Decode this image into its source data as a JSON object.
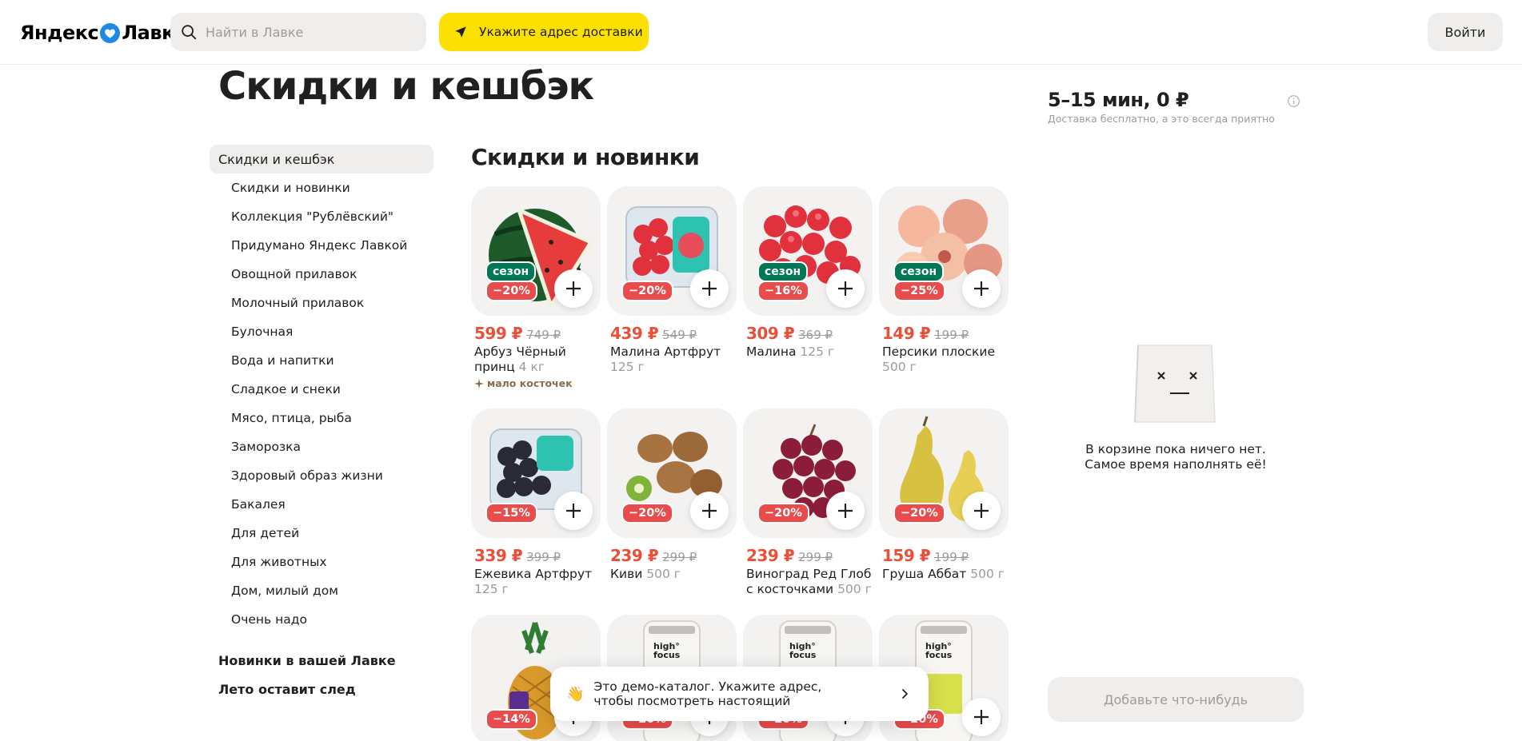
{
  "header": {
    "logo_left": "Яндекс",
    "logo_right": "Лавка",
    "search_placeholder": "Найти в Лавке",
    "address_label": "Укажите адрес доставки",
    "login_label": "Войти"
  },
  "page_title": "Скидки и кешбэк",
  "sidebar": {
    "active": "Скидки и кешбэк",
    "sub_items": [
      "Скидки и новинки",
      "Коллекция \"Рублёвский\"",
      "Придумано Яндекс Лавкой",
      "Овощной прилавок",
      "Молочный прилавок",
      "Булочная",
      "Вода и напитки",
      "Сладкое и снеки",
      "Мясо, птица, рыба",
      "Заморозка",
      "Здоровый образ жизни",
      "Бакалея",
      "Для детей",
      "Для животных",
      "Дом, милый дом",
      "Очень надо"
    ],
    "main_items": [
      "Новинки в вашей Лавке",
      "Лето оставит след"
    ]
  },
  "section_title": "Скидки и новинки",
  "products": [
    {
      "season": "сезон",
      "discount": "−20%",
      "price": "599 ₽",
      "old_price": "749 ₽",
      "name": "Арбуз Чёрный принц",
      "weight": "4 кг",
      "tag": "мало косточек",
      "art": "watermelon"
    },
    {
      "season": "",
      "discount": "−20%",
      "price": "439 ₽",
      "old_price": "549 ₽",
      "name": "Малина Артфрут",
      "weight": "125 г",
      "tag": "",
      "art": "raspberry-box"
    },
    {
      "season": "сезон",
      "discount": "−16%",
      "price": "309 ₽",
      "old_price": "369 ₽",
      "name": "Малина",
      "weight": "125 г",
      "tag": "",
      "art": "raspberry"
    },
    {
      "season": "сезон",
      "discount": "−25%",
      "price": "149 ₽",
      "old_price": "199 ₽",
      "name": "Персики плоские",
      "weight": "500 г",
      "tag": "",
      "art": "peach"
    },
    {
      "season": "",
      "discount": "−15%",
      "price": "339 ₽",
      "old_price": "399 ₽",
      "name": "Ежевика Артфрут",
      "weight": "125 г",
      "tag": "",
      "art": "blackberry-box"
    },
    {
      "season": "",
      "discount": "−20%",
      "price": "239 ₽",
      "old_price": "299 ₽",
      "name": "Киви",
      "weight": "500 г",
      "tag": "",
      "art": "kiwi"
    },
    {
      "season": "",
      "discount": "−20%",
      "price": "239 ₽",
      "old_price": "299 ₽",
      "name": "Виноград Ред Глоб с косточками",
      "weight": "500 г",
      "tag": "",
      "art": "grapes"
    },
    {
      "season": "",
      "discount": "−20%",
      "price": "159 ₽",
      "old_price": "199 ₽",
      "name": "Груша Аббат",
      "weight": "500 г",
      "tag": "",
      "art": "pear"
    },
    {
      "season": "",
      "discount": "−14%",
      "price": "",
      "old_price": "",
      "name": "",
      "weight": "",
      "tag": "",
      "art": "pineapple"
    },
    {
      "season": "",
      "discount": "−20%",
      "price": "",
      "old_price": "",
      "name": "",
      "weight": "",
      "tag": "",
      "art": "can-orange",
      "can_label": "high° focus"
    },
    {
      "season": "",
      "discount": "−20%",
      "price": "",
      "old_price": "",
      "name": "",
      "weight": "",
      "tag": "",
      "art": "can-yellow",
      "can_label": "high° focus"
    },
    {
      "season": "",
      "discount": "−20%",
      "price": "",
      "old_price": "",
      "name": "",
      "weight": "",
      "tag": "",
      "art": "can-green",
      "can_label": "high° focus"
    }
  ],
  "cart": {
    "delivery_title": "5–15 мин, 0 ₽",
    "delivery_sub": "Доставка бесплатно, а это всегда приятно",
    "empty_line1": "В корзине пока ничего нет.",
    "empty_line2": "Самое время наполнять её!",
    "add_button": "Добавьте что-нибудь"
  },
  "toast": {
    "emoji": "👋",
    "message": "Это демо-каталог. Укажите адрес, чтобы посмотреть настоящий"
  },
  "colors": {
    "accent_yellow": "#fce000",
    "discount_red": "#e94c4c",
    "price_red": "#e8503a",
    "season_green": "#007856",
    "brand_blue": "#1e88e5"
  }
}
